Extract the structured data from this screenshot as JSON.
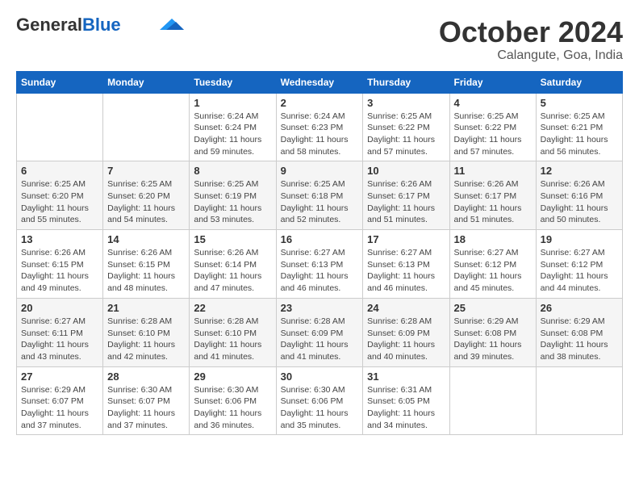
{
  "header": {
    "logo_general": "General",
    "logo_blue": "Blue",
    "month": "October 2024",
    "location": "Calangute, Goa, India"
  },
  "days_of_week": [
    "Sunday",
    "Monday",
    "Tuesday",
    "Wednesday",
    "Thursday",
    "Friday",
    "Saturday"
  ],
  "weeks": [
    [
      {
        "day": "",
        "sunrise": "",
        "sunset": "",
        "daylight": ""
      },
      {
        "day": "",
        "sunrise": "",
        "sunset": "",
        "daylight": ""
      },
      {
        "day": "1",
        "sunrise": "Sunrise: 6:24 AM",
        "sunset": "Sunset: 6:24 PM",
        "daylight": "Daylight: 11 hours and 59 minutes."
      },
      {
        "day": "2",
        "sunrise": "Sunrise: 6:24 AM",
        "sunset": "Sunset: 6:23 PM",
        "daylight": "Daylight: 11 hours and 58 minutes."
      },
      {
        "day": "3",
        "sunrise": "Sunrise: 6:25 AM",
        "sunset": "Sunset: 6:22 PM",
        "daylight": "Daylight: 11 hours and 57 minutes."
      },
      {
        "day": "4",
        "sunrise": "Sunrise: 6:25 AM",
        "sunset": "Sunset: 6:22 PM",
        "daylight": "Daylight: 11 hours and 57 minutes."
      },
      {
        "day": "5",
        "sunrise": "Sunrise: 6:25 AM",
        "sunset": "Sunset: 6:21 PM",
        "daylight": "Daylight: 11 hours and 56 minutes."
      }
    ],
    [
      {
        "day": "6",
        "sunrise": "Sunrise: 6:25 AM",
        "sunset": "Sunset: 6:20 PM",
        "daylight": "Daylight: 11 hours and 55 minutes."
      },
      {
        "day": "7",
        "sunrise": "Sunrise: 6:25 AM",
        "sunset": "Sunset: 6:20 PM",
        "daylight": "Daylight: 11 hours and 54 minutes."
      },
      {
        "day": "8",
        "sunrise": "Sunrise: 6:25 AM",
        "sunset": "Sunset: 6:19 PM",
        "daylight": "Daylight: 11 hours and 53 minutes."
      },
      {
        "day": "9",
        "sunrise": "Sunrise: 6:25 AM",
        "sunset": "Sunset: 6:18 PM",
        "daylight": "Daylight: 11 hours and 52 minutes."
      },
      {
        "day": "10",
        "sunrise": "Sunrise: 6:26 AM",
        "sunset": "Sunset: 6:17 PM",
        "daylight": "Daylight: 11 hours and 51 minutes."
      },
      {
        "day": "11",
        "sunrise": "Sunrise: 6:26 AM",
        "sunset": "Sunset: 6:17 PM",
        "daylight": "Daylight: 11 hours and 51 minutes."
      },
      {
        "day": "12",
        "sunrise": "Sunrise: 6:26 AM",
        "sunset": "Sunset: 6:16 PM",
        "daylight": "Daylight: 11 hours and 50 minutes."
      }
    ],
    [
      {
        "day": "13",
        "sunrise": "Sunrise: 6:26 AM",
        "sunset": "Sunset: 6:15 PM",
        "daylight": "Daylight: 11 hours and 49 minutes."
      },
      {
        "day": "14",
        "sunrise": "Sunrise: 6:26 AM",
        "sunset": "Sunset: 6:15 PM",
        "daylight": "Daylight: 11 hours and 48 minutes."
      },
      {
        "day": "15",
        "sunrise": "Sunrise: 6:26 AM",
        "sunset": "Sunset: 6:14 PM",
        "daylight": "Daylight: 11 hours and 47 minutes."
      },
      {
        "day": "16",
        "sunrise": "Sunrise: 6:27 AM",
        "sunset": "Sunset: 6:13 PM",
        "daylight": "Daylight: 11 hours and 46 minutes."
      },
      {
        "day": "17",
        "sunrise": "Sunrise: 6:27 AM",
        "sunset": "Sunset: 6:13 PM",
        "daylight": "Daylight: 11 hours and 46 minutes."
      },
      {
        "day": "18",
        "sunrise": "Sunrise: 6:27 AM",
        "sunset": "Sunset: 6:12 PM",
        "daylight": "Daylight: 11 hours and 45 minutes."
      },
      {
        "day": "19",
        "sunrise": "Sunrise: 6:27 AM",
        "sunset": "Sunset: 6:12 PM",
        "daylight": "Daylight: 11 hours and 44 minutes."
      }
    ],
    [
      {
        "day": "20",
        "sunrise": "Sunrise: 6:27 AM",
        "sunset": "Sunset: 6:11 PM",
        "daylight": "Daylight: 11 hours and 43 minutes."
      },
      {
        "day": "21",
        "sunrise": "Sunrise: 6:28 AM",
        "sunset": "Sunset: 6:10 PM",
        "daylight": "Daylight: 11 hours and 42 minutes."
      },
      {
        "day": "22",
        "sunrise": "Sunrise: 6:28 AM",
        "sunset": "Sunset: 6:10 PM",
        "daylight": "Daylight: 11 hours and 41 minutes."
      },
      {
        "day": "23",
        "sunrise": "Sunrise: 6:28 AM",
        "sunset": "Sunset: 6:09 PM",
        "daylight": "Daylight: 11 hours and 41 minutes."
      },
      {
        "day": "24",
        "sunrise": "Sunrise: 6:28 AM",
        "sunset": "Sunset: 6:09 PM",
        "daylight": "Daylight: 11 hours and 40 minutes."
      },
      {
        "day": "25",
        "sunrise": "Sunrise: 6:29 AM",
        "sunset": "Sunset: 6:08 PM",
        "daylight": "Daylight: 11 hours and 39 minutes."
      },
      {
        "day": "26",
        "sunrise": "Sunrise: 6:29 AM",
        "sunset": "Sunset: 6:08 PM",
        "daylight": "Daylight: 11 hours and 38 minutes."
      }
    ],
    [
      {
        "day": "27",
        "sunrise": "Sunrise: 6:29 AM",
        "sunset": "Sunset: 6:07 PM",
        "daylight": "Daylight: 11 hours and 37 minutes."
      },
      {
        "day": "28",
        "sunrise": "Sunrise: 6:30 AM",
        "sunset": "Sunset: 6:07 PM",
        "daylight": "Daylight: 11 hours and 37 minutes."
      },
      {
        "day": "29",
        "sunrise": "Sunrise: 6:30 AM",
        "sunset": "Sunset: 6:06 PM",
        "daylight": "Daylight: 11 hours and 36 minutes."
      },
      {
        "day": "30",
        "sunrise": "Sunrise: 6:30 AM",
        "sunset": "Sunset: 6:06 PM",
        "daylight": "Daylight: 11 hours and 35 minutes."
      },
      {
        "day": "31",
        "sunrise": "Sunrise: 6:31 AM",
        "sunset": "Sunset: 6:05 PM",
        "daylight": "Daylight: 11 hours and 34 minutes."
      },
      {
        "day": "",
        "sunrise": "",
        "sunset": "",
        "daylight": ""
      },
      {
        "day": "",
        "sunrise": "",
        "sunset": "",
        "daylight": ""
      }
    ]
  ]
}
